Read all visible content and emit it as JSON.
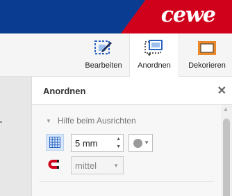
{
  "header": {
    "logo_text": "cewe",
    "colors": {
      "blue": "#0a3d91",
      "red": "#d0011b"
    }
  },
  "toolbar": {
    "items": [
      {
        "label": "Bearbeiten",
        "icon": "edit-selection-icon"
      },
      {
        "label": "Anordnen",
        "icon": "arrange-icon",
        "active": true
      },
      {
        "label": "Dekorieren",
        "icon": "decorate-frame-icon"
      }
    ]
  },
  "panel": {
    "title": "Anordnen",
    "close_label": "✕",
    "section": {
      "title": "Hilfe beim Ausrichten",
      "grid_icon": "grid-icon",
      "grid_size": {
        "value": "5 mm"
      },
      "grid_color": {
        "value": "#9a9a9a"
      },
      "magnet_icon": "magnet-icon",
      "snap_strength": {
        "value": "mittel"
      }
    }
  }
}
